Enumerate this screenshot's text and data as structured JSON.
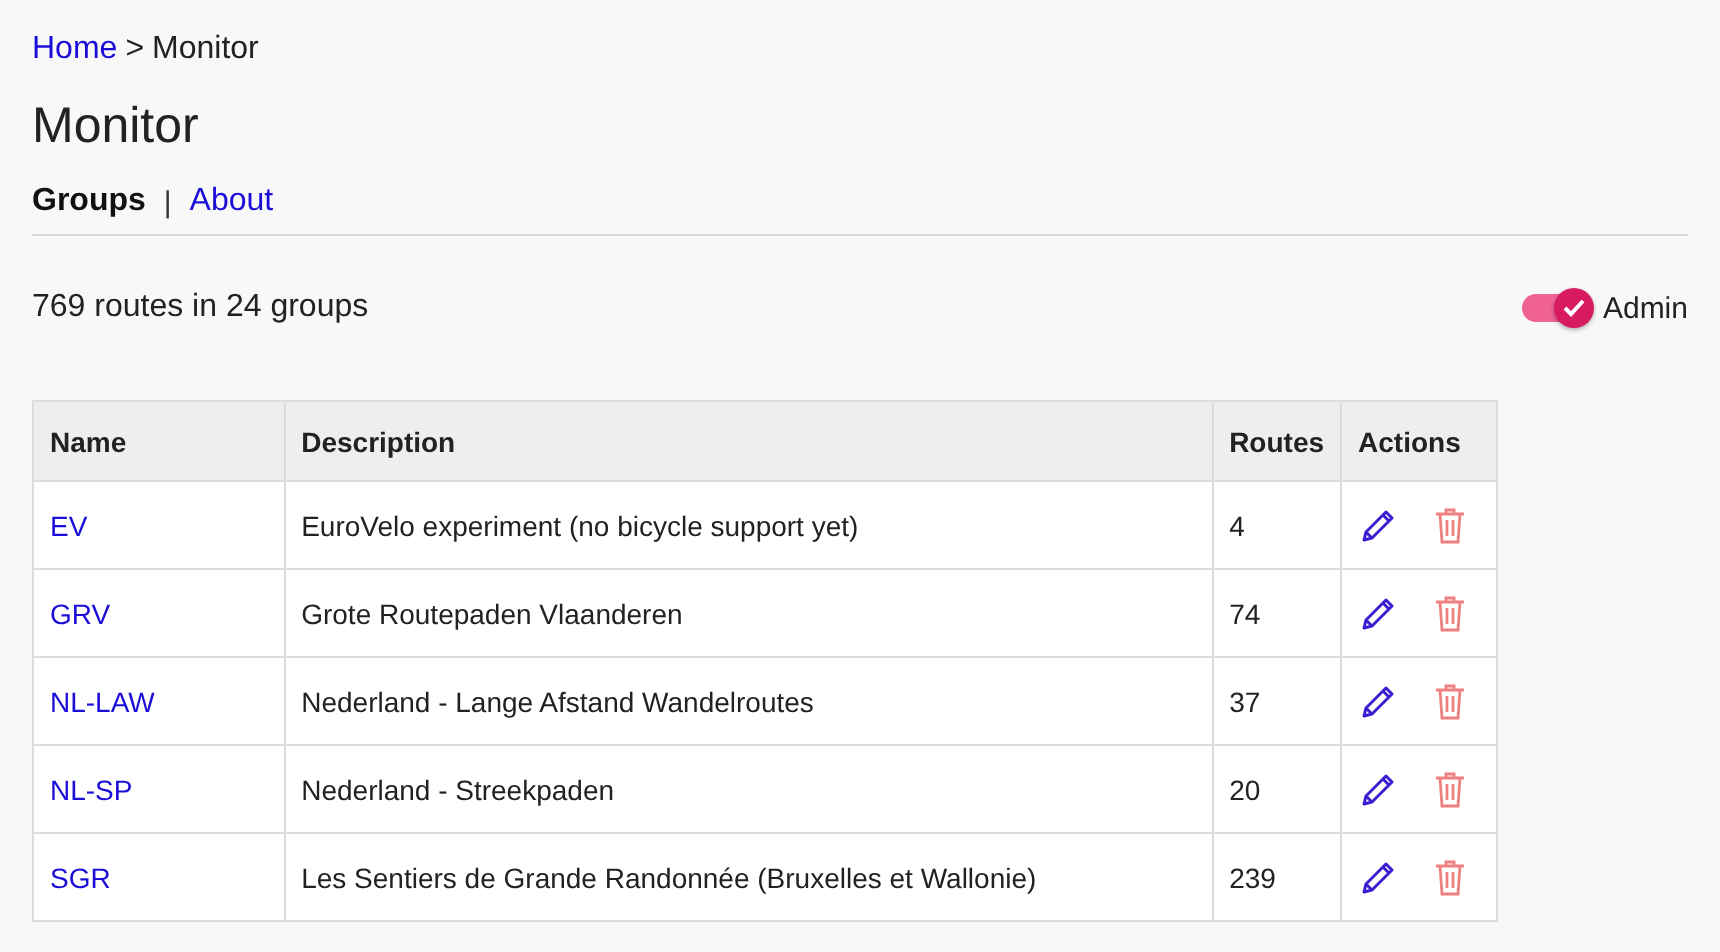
{
  "breadcrumb": {
    "links": [
      {
        "label": "Home"
      }
    ],
    "separator": ">",
    "current": "Monitor"
  },
  "title": "Monitor",
  "tabs": [
    {
      "label": "Groups",
      "selected": true
    },
    {
      "label": "About",
      "selected": false
    }
  ],
  "tab_separator": "|",
  "summary": "769 routes in 24 groups",
  "admin_toggle": {
    "label": "Admin",
    "on": true
  },
  "table": {
    "columns": [
      "Name",
      "Description",
      "Routes",
      "Actions"
    ],
    "rows": [
      {
        "name": "EV",
        "description": "EuroVelo experiment (no bicycle support yet)",
        "routes": "4"
      },
      {
        "name": "GRV",
        "description": "Grote Routepaden Vlaanderen",
        "routes": "74"
      },
      {
        "name": "NL-LAW",
        "description": "Nederland - Lange Afstand Wandelroutes",
        "routes": "37"
      },
      {
        "name": "NL-SP",
        "description": "Nederland - Streekpaden",
        "routes": "20"
      },
      {
        "name": "SGR",
        "description": "Les Sentiers de Grande Randonnée (Bruxelles et Wallonie)",
        "routes": "239"
      }
    ]
  }
}
